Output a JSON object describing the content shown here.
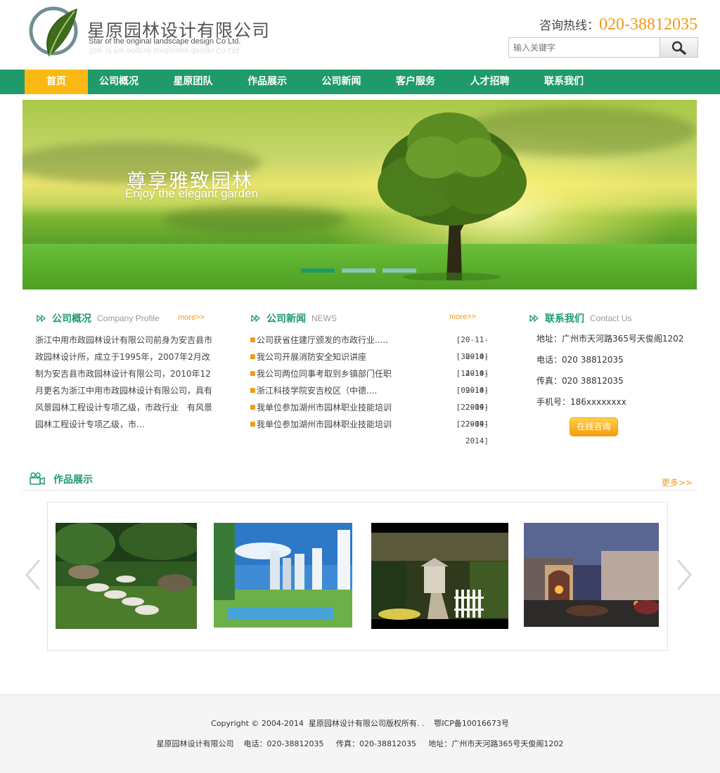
{
  "header": {
    "company_cn": "星原园林设计有限公司",
    "company_en": "Star of the original landscape design Co Ltd.",
    "hotline_label": "咨询热线：",
    "hotline_number": "020-38812035",
    "search_placeholder": "输入关键字",
    "search_icon": "magnifier-icon"
  },
  "nav": {
    "items": [
      "首页",
      "公司概况",
      "星原团队",
      "作品展示",
      "公司新闻",
      "客户服务",
      "人才招聘",
      "联系我们"
    ],
    "active_index": 0
  },
  "banner": {
    "slogan_cn": "尊享雅致园林",
    "slogan_en": "Enjoy the elegant garden",
    "slides": 3,
    "active_slide": 0
  },
  "about": {
    "title": "公司概况",
    "title_en": "Company Profile",
    "more": "more>>",
    "text": "浙江中用市政园林设计有限公司前身为安吉县市政园林设计所，成立于1995年，2007年2月改制为安吉县市政园林设计有限公司，2010年12月更名为浙江中用市政园林设计有限公司，具有风景园林工程设计专项乙级，市政行业　有风景园林工程设计专项乙级，市..."
  },
  "news": {
    "title": "公司新闻",
    "title_en": "NEWS",
    "more": "more>>",
    "items": [
      {
        "title": "公司获省住建厅颁发的市政行业.....",
        "date": "[20-11-2014]"
      },
      {
        "title": "我公司开展消防安全知识讲座",
        "date": "[30-10-2014]"
      },
      {
        "title": "我公司两位同事考取到乡镇部门任职",
        "date": "[14-10-2014]"
      },
      {
        "title": "浙江科技学院安吉校区（中德....",
        "date": "[09-10-2014]"
      },
      {
        "title": "我单位参加湖州市园林职业技能培训",
        "date": "[22-09-2014]"
      },
      {
        "title": "我单位参加湖州市园林职业技能培训",
        "date": "[22-09-2014]"
      }
    ]
  },
  "contact": {
    "title": "联系我们",
    "title_en": "Contact Us",
    "address": "地址：广州市天河路365号天俊阁1202",
    "phone": "电话：020 38812035",
    "fax": "传真：020 38812035",
    "mobile": "手机号：186xxxxxxxx",
    "button": "在线咨询"
  },
  "works": {
    "title": "作品展示",
    "more": "更多>>"
  },
  "footer": {
    "line1": "Copyright © 2004-2014  星原园林设计有限公司版权所有. .    鄂ICP备10016673号",
    "line2": "星原园林设计有限公司    电话：020-38812035     传真：020-38812035     地址：广州市天河路365号天俊阁1202"
  },
  "colors": {
    "brand_green": "#1f9a6b",
    "accent_orange": "#f29a16",
    "nav_active": "#fdb913"
  }
}
